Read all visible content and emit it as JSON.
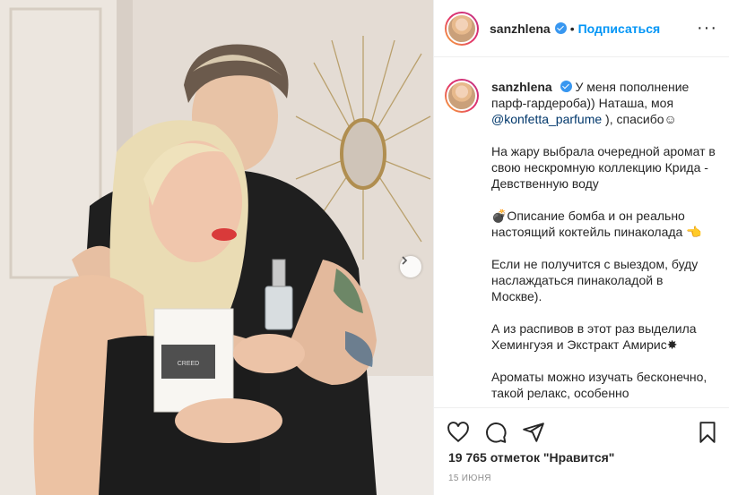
{
  "post": {
    "username": "sanzhlena",
    "follow_label": "Подписаться",
    "more_label": "···",
    "caption": {
      "username": "sanzhlena",
      "line1_text": "У меня пополнение парф-гардероба)) Наташа, моя ",
      "mention": "@konfetta_parfume",
      "line1_tail": " ), спасибо☺",
      "p2": "На жару выбрала очередной аромат в свою нескромную коллекцию Крида - Девственную воду",
      "p3": "💣Описание бомба и он реально настоящий коктейль пинаколада 👈",
      "p4": "Если не получится с выездом, буду наслаждаться пинаколадой в Москве).",
      "p5": "А из распивов в этот раз выделила Хемингуэя и Экстракт Амирис✸",
      "p6": "Ароматы можно изучать бесконечно, такой релакс, особенно"
    },
    "likes_text": "19 765 отметок \"Нравится\"",
    "date_text": "15 ИЮНЯ",
    "photo_box_brand": "CREED"
  },
  "icons": {
    "like": "heart-icon",
    "comment": "comment-icon",
    "share": "share-icon",
    "save": "bookmark-icon",
    "next": "chevron-right-icon"
  },
  "colors": {
    "follow": "#0095f6",
    "verified": "#3897f0",
    "mention": "#00376b"
  }
}
